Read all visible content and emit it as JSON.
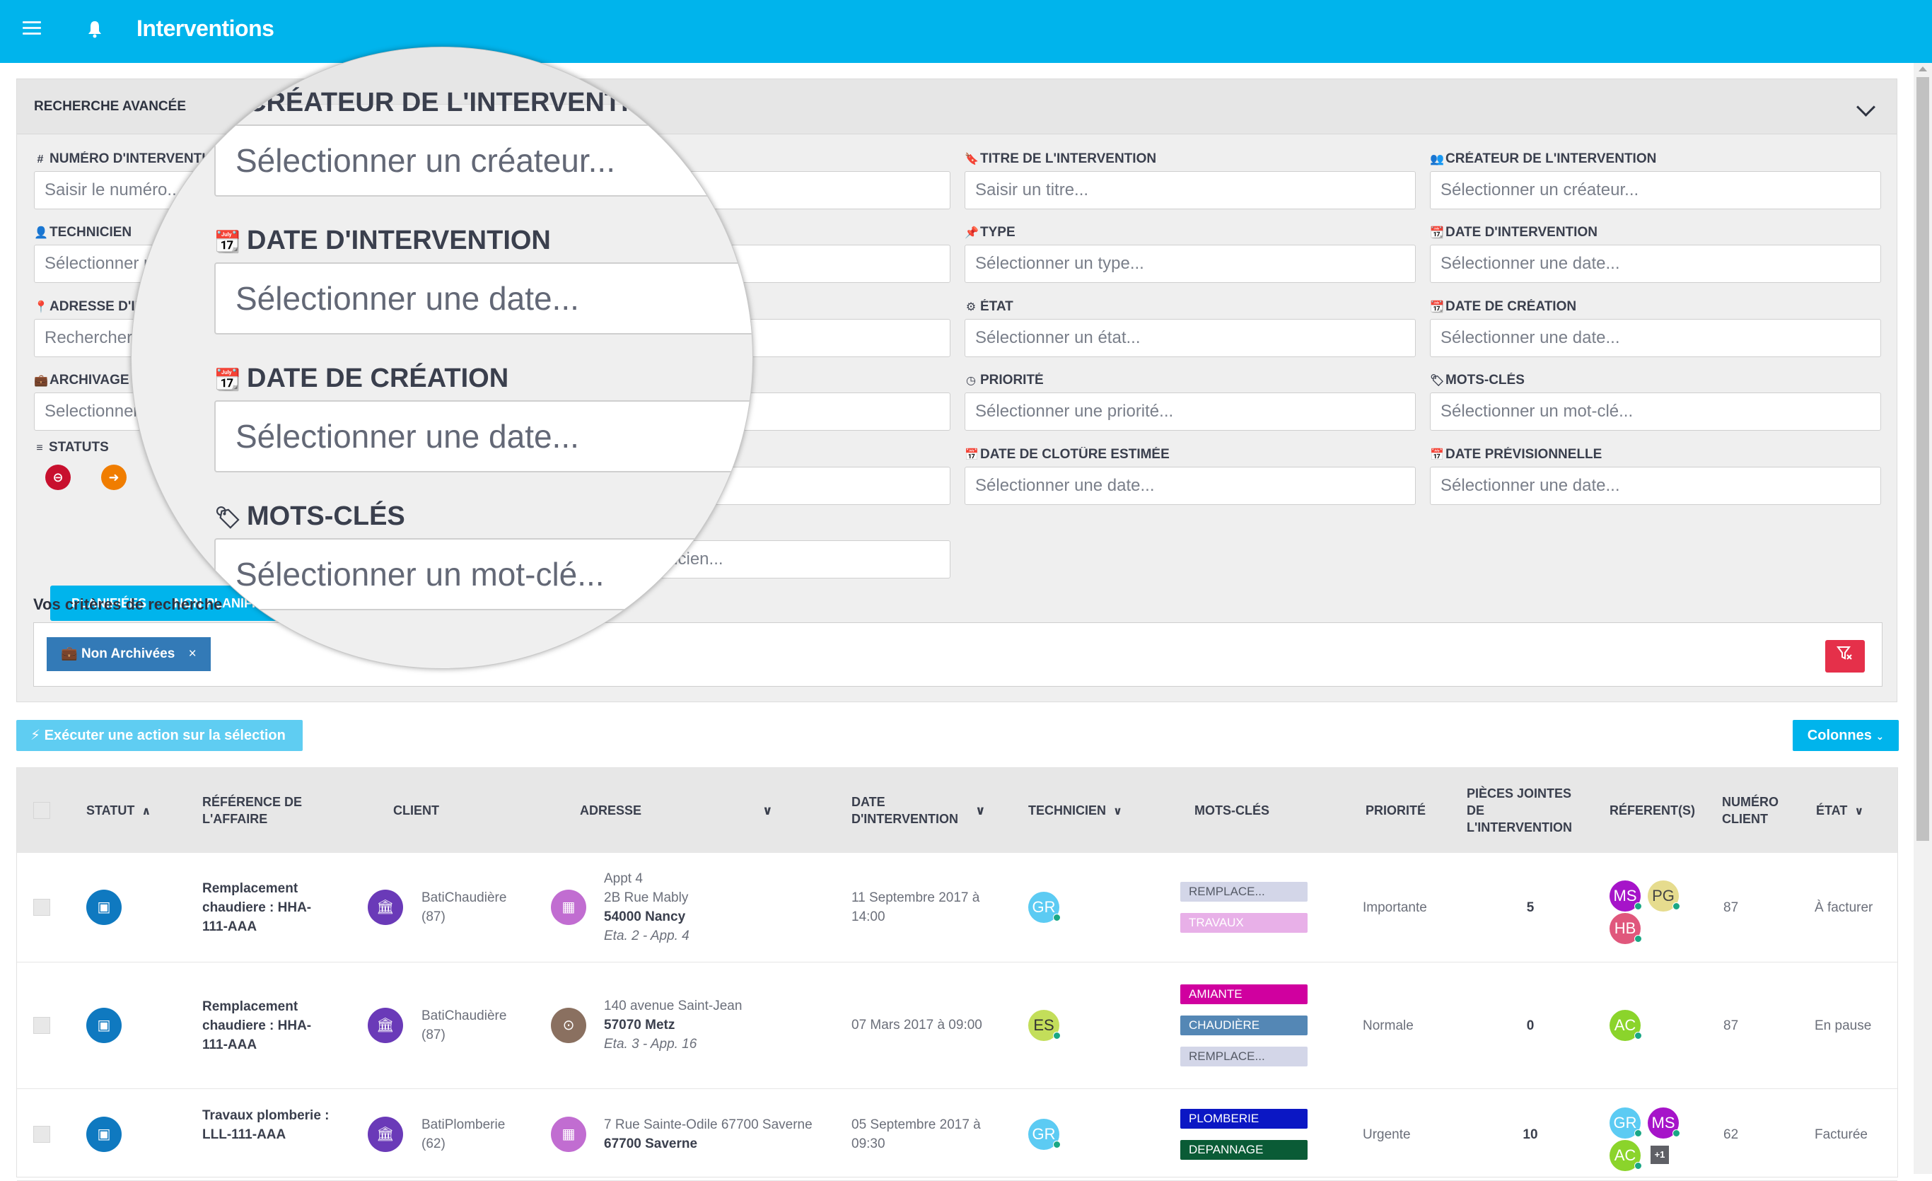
{
  "header": {
    "title": "Interventions",
    "menu_icon": "hamburger-icon",
    "bell_icon": "bell-icon"
  },
  "search_panel": {
    "title": "RECHERCHE AVANCÉE",
    "collapse_icon": "chevron-down-icon",
    "fields": [
      {
        "id": "numero",
        "label": "NUMÉRO D'INTERVENTION",
        "icon": "#",
        "placeholder": "Saisir le numéro..."
      },
      {
        "id": "technicien",
        "label": "TECHNICIEN",
        "icon": "👤",
        "placeholder": "Sélectionner un technicien..."
      },
      {
        "id": "adresse",
        "label": "ADRESSE D'INTERVENTION",
        "icon": "📍",
        "placeholder": "Rechercher une adresse..."
      },
      {
        "id": "archivage",
        "label": "ARCHIVAGE",
        "icon": "💼",
        "placeholder": "Selectionner..."
      },
      {
        "id": "titre",
        "label": "TITRE DE L'INTERVENTION",
        "icon": "🔖",
        "placeholder": "Saisir un titre..."
      },
      {
        "id": "type",
        "label": "TYPE",
        "icon": "📌",
        "placeholder": "Sélectionner un type..."
      },
      {
        "id": "etat",
        "label": "ÉTAT",
        "icon": "⚙",
        "placeholder": "Sélectionner un état..."
      },
      {
        "id": "priorite",
        "label": "PRIORITÉ",
        "icon": "◷",
        "placeholder": "Sélectionner une priorité..."
      },
      {
        "id": "cloture",
        "label": "DATE DE CLOTÛRE ESTIMÉE",
        "icon": "📅",
        "placeholder": "Sélectionner une date..."
      },
      {
        "id": "createur",
        "label": "CRÉATEUR DE L'INTERVENTION",
        "icon": "👥",
        "placeholder": "Sélectionner un créateur..."
      },
      {
        "id": "date_intervention",
        "label": "DATE D'INTERVENTION",
        "icon": "📆",
        "placeholder": "Sélectionner une date..."
      },
      {
        "id": "date_creation",
        "label": "DATE DE CRÉATION",
        "icon": "📆",
        "placeholder": "Sélectionner une date..."
      },
      {
        "id": "mots_cles",
        "label": "MOTS-CLÉS",
        "icon": "🏷",
        "placeholder": "Sélectionner un mot-clé..."
      },
      {
        "id": "previsionnelle",
        "label": "DATE PRÉVISIONNELLE",
        "icon": "📅",
        "placeholder": "Sélectionner une date..."
      }
    ],
    "hidden_field_placeholder": "Sélectionner un technicien...",
    "statuts": {
      "label": "STATUTS",
      "icon": "≡",
      "buttons": [
        {
          "name": "bloquee",
          "glyph": "⊖",
          "color": "#c8102e"
        },
        {
          "name": "en-cours",
          "glyph": "➜",
          "color": "#f07d00"
        }
      ]
    },
    "tabs": [
      "PLANIFIÉES",
      "NON PLANIFIÉES"
    ],
    "criteria_label": "Vos critères de recherche",
    "criteria_chips": [
      {
        "label": "Non Archivées",
        "icon": "💼",
        "remove": "×"
      }
    ],
    "clear_filters_icon": "filter-clear-icon"
  },
  "magnifier": {
    "fields": [
      {
        "label": "CRÉATEUR DE L'INTERVENTION",
        "icon": "👥",
        "placeholder": "Sélectionner un créateur..."
      },
      {
        "label": "DATE D'INTERVENTION",
        "icon": "📆",
        "placeholder": "Sélectionner une date..."
      },
      {
        "label": "DATE DE CRÉATION",
        "icon": "📆",
        "placeholder": "Sélectionner une date..."
      },
      {
        "label": "MOTS-CLÉS",
        "icon": "🏷",
        "placeholder": "Sélectionner un mot-clé..."
      }
    ]
  },
  "toolbar": {
    "action_label": "Exécuter une action sur la sélection",
    "action_icon": "⚡",
    "columns_label": "Colonnes"
  },
  "table": {
    "columns": [
      "STATUT",
      "RÉFÉRENCE DE L'AFFAIRE",
      "CLIENT",
      "ADRESSE",
      "DATE D'INTERVENTION",
      "TECHNICIEN",
      "MOTS-CLÉS",
      "PRIORITÉ",
      "PIÈCES JOINTES DE L'INTERVENTION",
      "RÉFERENT(S)",
      "NUMÉRO CLIENT",
      "ÉTAT"
    ],
    "rows": [
      {
        "reference": "Remplacement chaudiere : HHA-111-AAA",
        "client_name": "BatiChaudière",
        "client_num": "(87)",
        "address_lines": [
          "Appt 4",
          "2B Rue Mably"
        ],
        "address_city": "54000 Nancy",
        "address_extra": "Eta. 2 - App. 4",
        "address_icon_color": "#c16dd1",
        "date": "11 Septembre 2017 à 14:00",
        "technician": {
          "initials": "GR",
          "color": "#5ccbf3"
        },
        "tags": [
          {
            "label": "REMPLACE...",
            "color": "#d3d6e8",
            "text": "#555a66"
          },
          {
            "label": "TRAVAUX",
            "color": "#e8b0e8",
            "text": "#ffffff"
          }
        ],
        "priority": "Importante",
        "attachments": "5",
        "referents": [
          {
            "initials": "MS",
            "color": "#a614c9"
          },
          {
            "initials": "PG",
            "color": "#e6dc8e",
            "text": "#444"
          },
          {
            "initials": "HB",
            "color": "#e0577c"
          }
        ],
        "referents_more": "",
        "client_number": "87",
        "state": "À facturer"
      },
      {
        "reference": "Remplacement chaudiere : HHA-111-AAA",
        "client_name": "BatiChaudière",
        "client_num": "(87)",
        "address_lines": [
          "140 avenue Saint-Jean"
        ],
        "address_city": "57070 Metz",
        "address_extra": "Eta. 3 - App. 16",
        "address_icon_color": "#8a7060",
        "date": "07 Mars 2017 à 09:00",
        "technician": {
          "initials": "ES",
          "color": "#c3de5a",
          "text": "#333"
        },
        "tags": [
          {
            "label": "AMIANTE",
            "color": "#d0009f",
            "text": "#ffffff"
          },
          {
            "label": "CHAUDIÈRE",
            "color": "#5487b5",
            "text": "#ffffff"
          },
          {
            "label": "REMPLACE...",
            "color": "#d3d6e8",
            "text": "#555a66"
          }
        ],
        "priority": "Normale",
        "attachments": "0",
        "referents": [
          {
            "initials": "AC",
            "color": "#8bd42b"
          }
        ],
        "referents_more": "",
        "client_number": "87",
        "state": "En pause"
      },
      {
        "reference": "Travaux plomberie : LLL-111-AAA",
        "client_name": "BatiPlomberie",
        "client_num": "(62)",
        "address_lines": [
          "7 Rue Sainte-Odile 67700 Saverne"
        ],
        "address_city": "67700 Saverne",
        "address_extra": "",
        "address_icon_color": "#c16dd1",
        "date": "05 Septembre 2017 à 09:30",
        "technician": {
          "initials": "GR",
          "color": "#5ccbf3"
        },
        "tags": [
          {
            "label": "PLOMBERIE",
            "color": "#0b17c4",
            "text": "#ffffff"
          },
          {
            "label": "DEPANNAGE",
            "color": "#0a5b36",
            "text": "#ffffff"
          }
        ],
        "priority": "Urgente",
        "attachments": "10",
        "referents": [
          {
            "initials": "GR",
            "color": "#5ccbf3"
          },
          {
            "initials": "MS",
            "color": "#a614c9"
          },
          {
            "initials": "AC",
            "color": "#8bd42b"
          }
        ],
        "referents_more": "+1",
        "client_number": "62",
        "state": "Facturée"
      }
    ]
  },
  "colors": {
    "brand": "#00b4ec",
    "danger": "#e5304a",
    "chip": "#337ab7",
    "action_light": "#5fcdf2"
  }
}
